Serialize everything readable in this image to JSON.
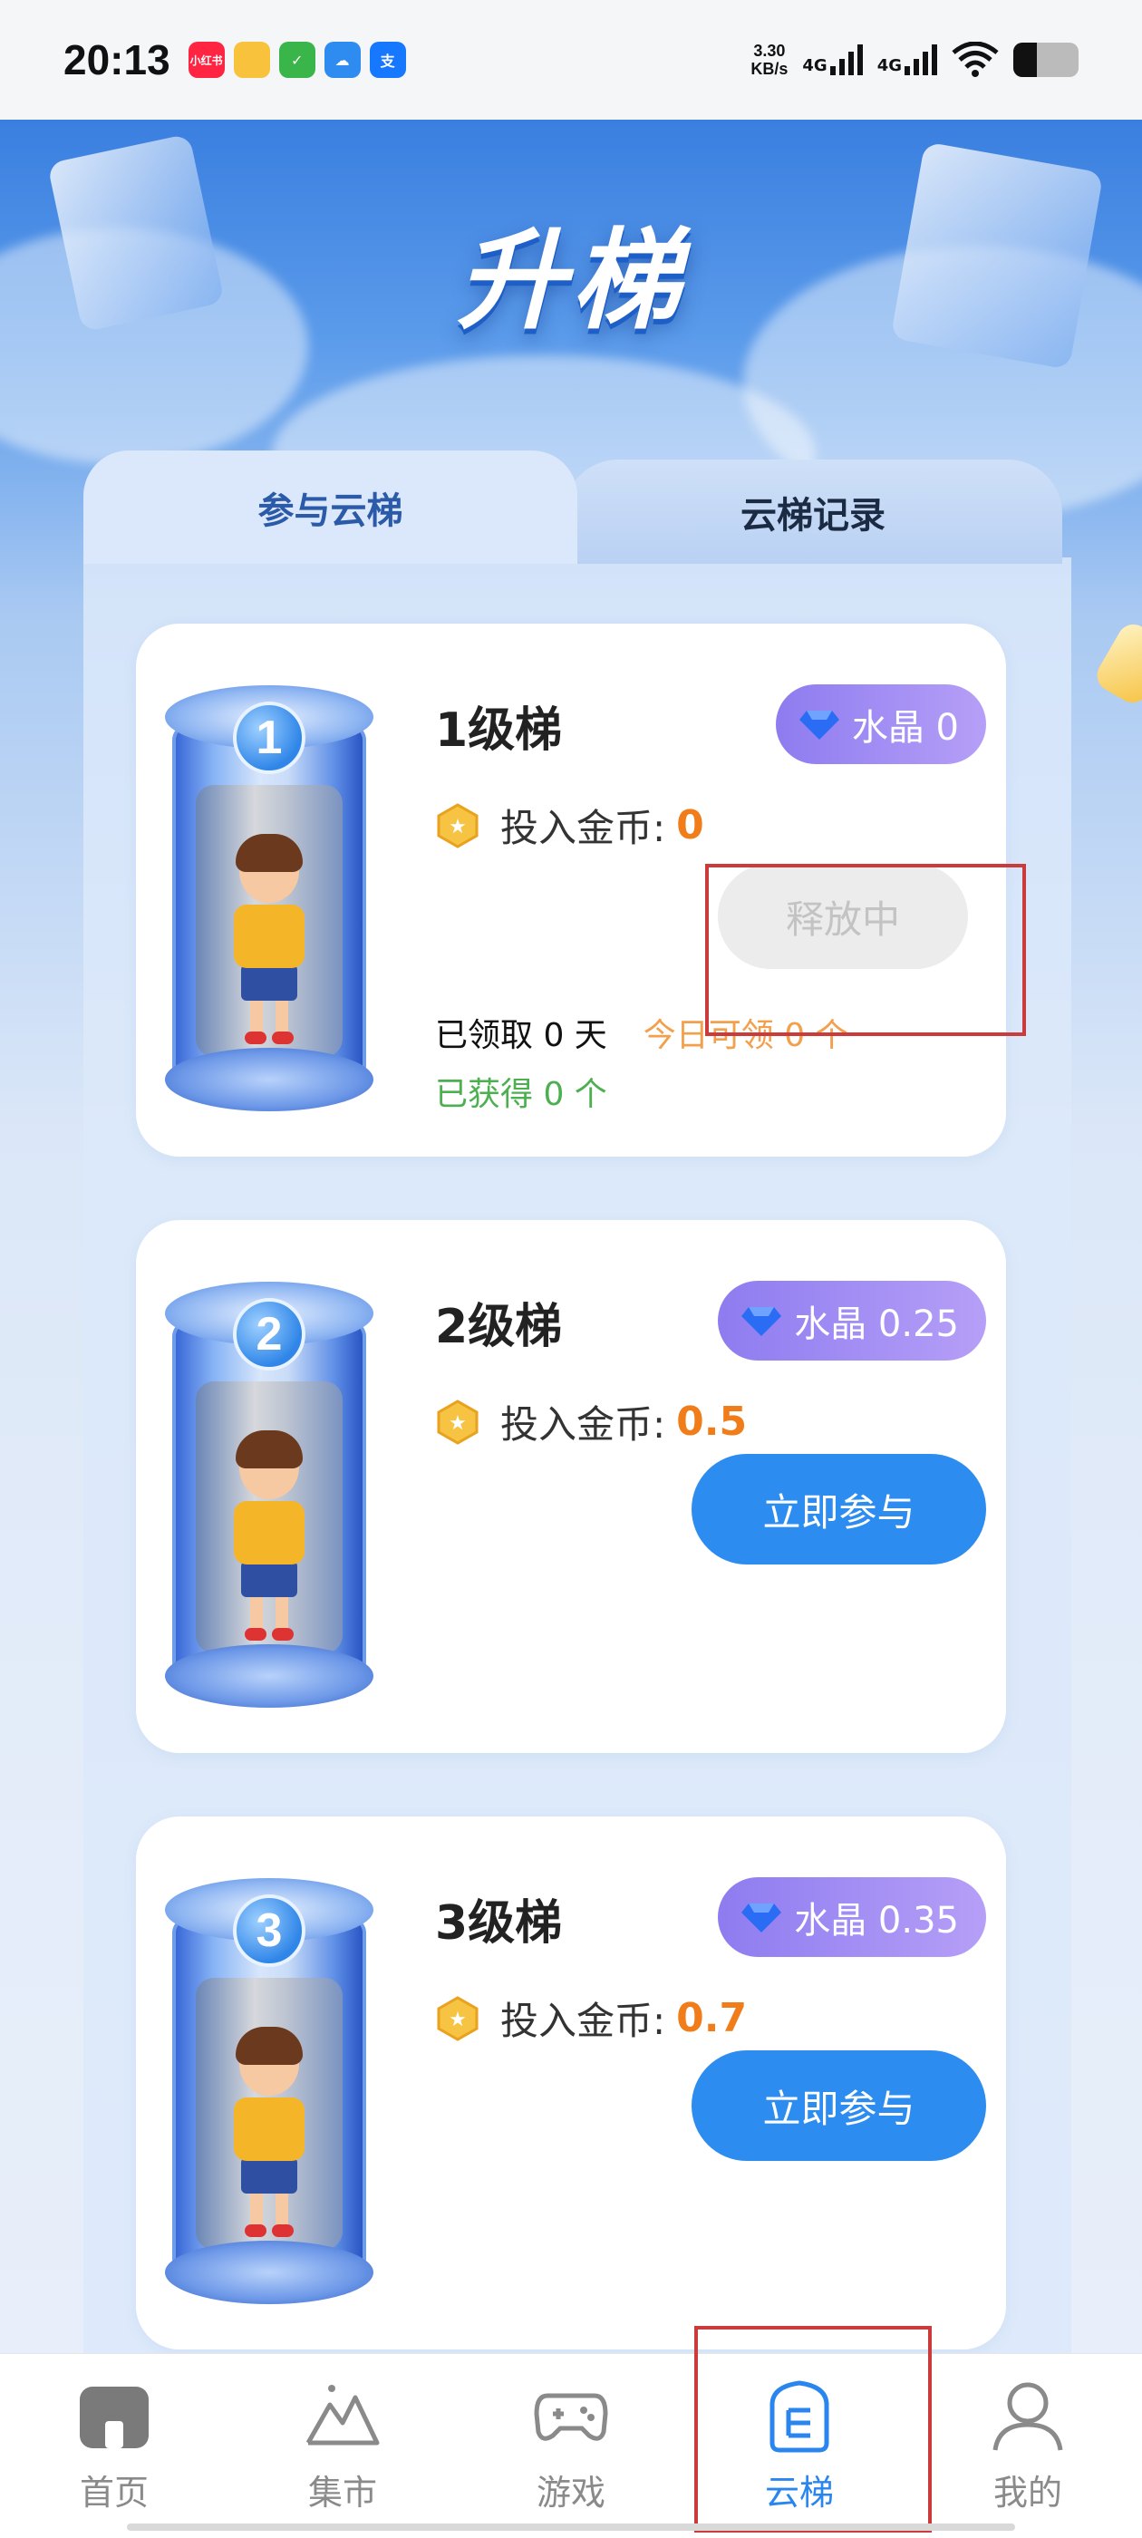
{
  "status_bar": {
    "time": "20:13",
    "net_speed_value": "3.30",
    "net_speed_unit": "KB/s",
    "signal1": "4G",
    "signal2": "4G",
    "app_icons": [
      "xiaohongshu-icon",
      "files-icon",
      "tasks-icon",
      "cloud-icon",
      "alipay-icon"
    ],
    "app_icon_text": {
      "xhs": "小红书",
      "alipay": "支"
    }
  },
  "hero": {
    "title": "升梯"
  },
  "tabs": {
    "active": "参与云梯",
    "inactive": "云梯记录"
  },
  "cards": [
    {
      "level_num": "1",
      "title": "1级梯",
      "crystal_label": "水晶 0",
      "coin_label": "投入金币:",
      "coin_value": "0",
      "button": "释放中",
      "button_state": "disabled",
      "claimed_days": "已领取 0 天",
      "today_claim": "今日可领 0 个",
      "earned": "已获得 0 个"
    },
    {
      "level_num": "2",
      "title": "2级梯",
      "crystal_label": "水晶 0.25",
      "coin_label": "投入金币:",
      "coin_value": "0.5",
      "button": "立即参与",
      "button_state": "enabled"
    },
    {
      "level_num": "3",
      "title": "3级梯",
      "crystal_label": "水晶 0.35",
      "coin_label": "投入金币:",
      "coin_value": "0.7",
      "button": "立即参与",
      "button_state": "enabled"
    }
  ],
  "bottom_nav": [
    {
      "label": "首页",
      "icon": "home-icon",
      "active": false
    },
    {
      "label": "集市",
      "icon": "mountain-icon",
      "active": false
    },
    {
      "label": "游戏",
      "icon": "gamepad-icon",
      "active": false
    },
    {
      "label": "云梯",
      "icon": "ladder-icon",
      "active": true
    },
    {
      "label": "我的",
      "icon": "user-icon",
      "active": false
    }
  ],
  "colors": {
    "accent": "#2c8cf0",
    "coin_value": "#f07d1a",
    "earned": "#4caf50",
    "today": "#f2a04c",
    "highlight": "#cc3b3b"
  }
}
